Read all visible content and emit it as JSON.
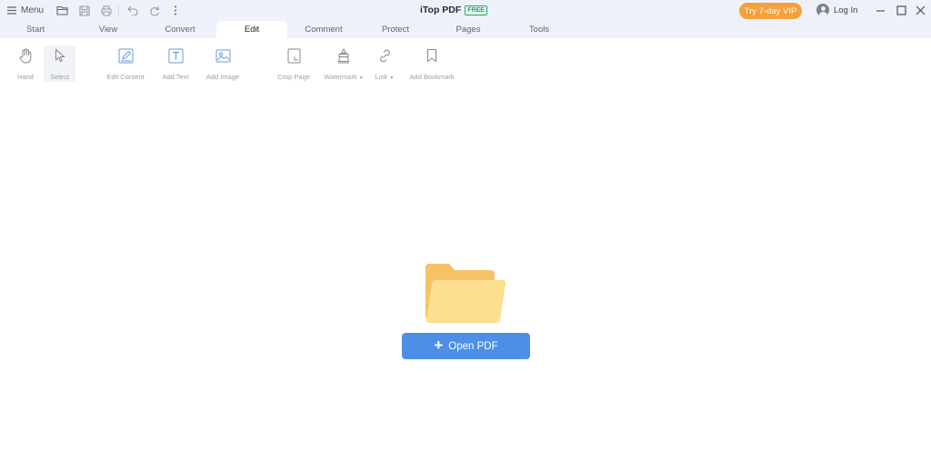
{
  "titlebar": {
    "menu_label": "Menu",
    "app_title": "iTop PDF",
    "free_badge": "FREE",
    "vip_button": "Try 7-day VIP",
    "login_label": "Log In"
  },
  "tabs": [
    {
      "label": "Start"
    },
    {
      "label": "View"
    },
    {
      "label": "Convert"
    },
    {
      "label": "Edit",
      "active": true
    },
    {
      "label": "Comment"
    },
    {
      "label": "Protect"
    },
    {
      "label": "Pages"
    },
    {
      "label": "Tools"
    }
  ],
  "toolbar": {
    "hand": "Hand",
    "select": "Select",
    "edit_content": "Edit Content",
    "add_text": "Add Text",
    "add_image": "Add Image",
    "crop_page": "Crop Page",
    "watermark": "Watermark",
    "link": "Link",
    "add_bookmark": "Add Bookmark"
  },
  "main": {
    "open_button": "Open PDF"
  },
  "colors": {
    "titlebar_bg": "#eef1f9",
    "accent_blue": "#4d8fe6",
    "vip_orange": "#f5a03a",
    "free_green": "#29a36a",
    "folder_yellow": "#fbd987"
  }
}
